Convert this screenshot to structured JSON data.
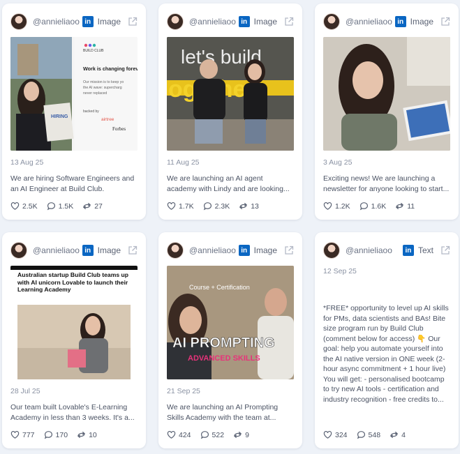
{
  "cards": [
    {
      "handle": "@annieliaoo",
      "type": "Image",
      "date": "13 Aug 25",
      "text": "We are hiring Software Engineers and an AI Engineer at Build Club. Flexible...",
      "likes": "2.5K",
      "comments": "1.5K",
      "shares": "27",
      "media_text": {
        "brand": "BUILD CLUB",
        "headline": "Work is changing forev",
        "body": "Our mission is to keep yo the AI wave: supercharg never replaced",
        "backed": "backed by",
        "logo1": "airtree",
        "logo2": "Forbes",
        "sign": "HIRING"
      }
    },
    {
      "handle": "@annieliaoo",
      "type": "Image",
      "date": "11 Aug 25",
      "text": "We are launching an AI agent academy with Lindy and are looking...",
      "likes": "1.7K",
      "comments": "2.3K",
      "shares": "13",
      "media_text": {
        "wall1": "let's build",
        "wall2": "ogethe"
      }
    },
    {
      "handle": "@annieliaoo",
      "type": "Image",
      "date": "3 Aug 25",
      "text": "Exciting news! We are launching a newsletter for anyone looking to start...",
      "likes": "1.2K",
      "comments": "1.6K",
      "shares": "11"
    },
    {
      "handle": "@annieliaoo",
      "type": "Image",
      "date": "28 Jul 25",
      "text": "Our team built Lovable's E-Learning Academy in less than 3 weeks. It's a...",
      "likes": "777",
      "comments": "170",
      "shares": "10",
      "media_text": {
        "headline": "Australian startup Build Club teams up with AI unicorn Lovable to launch their Learning Academy"
      }
    },
    {
      "handle": "@annieliaoo",
      "type": "Image",
      "date": "21 Sep 25",
      "text": "We are launching an AI Prompting Skills Academy with the team at...",
      "likes": "424",
      "comments": "522",
      "shares": "9",
      "media_text": {
        "top": "Course + Certification",
        "main": "AI PROMPTING",
        "sub": "ADVANCED SKILLS"
      }
    },
    {
      "handle": "@annieliaoo",
      "type": "Text",
      "date": "12 Sep 25",
      "text": "*FREE* opportunity to level up AI skills for PMs, data scientists and BAs! Bite size program run by Build Club (comment below for access) 👇 Our goal: help you automate yourself into the AI native version in ONE week (2-hour async commitment + 1 hour live) You will get: - personalised bootcamp to try new AI tools - certification and industry recognition - free credits to...",
      "likes": "324",
      "comments": "548",
      "shares": "4"
    }
  ],
  "icons": {
    "platform": "linkedin-icon",
    "open": "external-link-icon",
    "like": "heart-icon",
    "comment": "comment-icon",
    "share": "share-icon"
  },
  "colors": {
    "linkedin": "#0a66c2",
    "background": "#eef2f8",
    "card": "#ffffff"
  }
}
